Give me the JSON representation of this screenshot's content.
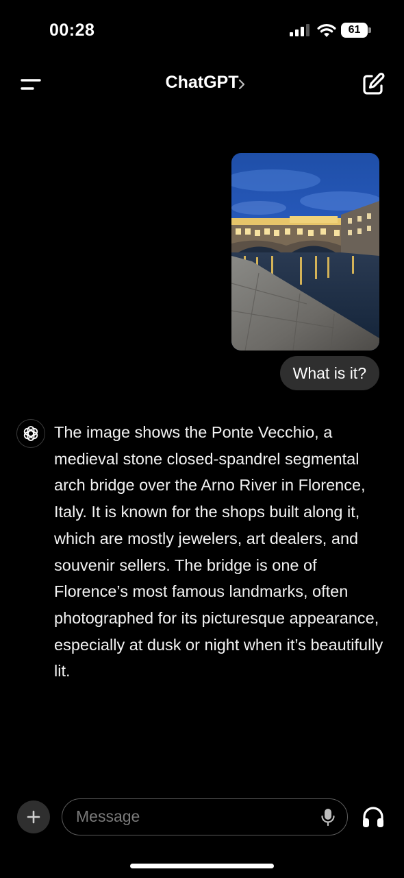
{
  "status_bar": {
    "time": "00:28",
    "battery_level": "61",
    "signal_icon": "cellular-signal-icon",
    "wifi_icon": "wifi-icon",
    "battery_icon": "battery-icon"
  },
  "header": {
    "title": "ChatGPT",
    "menu_icon": "menu-icon",
    "chevron_icon": "chevron-right-icon",
    "new_chat_icon": "new-chat-edit-icon"
  },
  "conversation": {
    "user_image_icon": "attached-photo",
    "user_message": "What is it?",
    "assistant_avatar_icon": "chatgpt-logo-icon",
    "assistant_message": "The image shows the Ponte Vecchio, a medieval stone closed-spandrel segmental arch bridge over the Arno River in Florence, Italy. It is known for the shops built along it, which are mostly jewelers, art dealers, and souvenir sellers. The bridge is one of Florence’s most famous landmarks, often photographed for its picturesque appearance, especially at dusk or night when it’s beautifully lit."
  },
  "composer": {
    "placeholder": "Message",
    "value": "",
    "plus_icon": "plus-icon",
    "mic_icon": "microphone-icon",
    "voice_icon": "headphones-icon"
  },
  "colors": {
    "background": "#000000",
    "bubble": "#2f2f2f",
    "placeholder": "#7a7a7a",
    "text": "#ffffff"
  }
}
